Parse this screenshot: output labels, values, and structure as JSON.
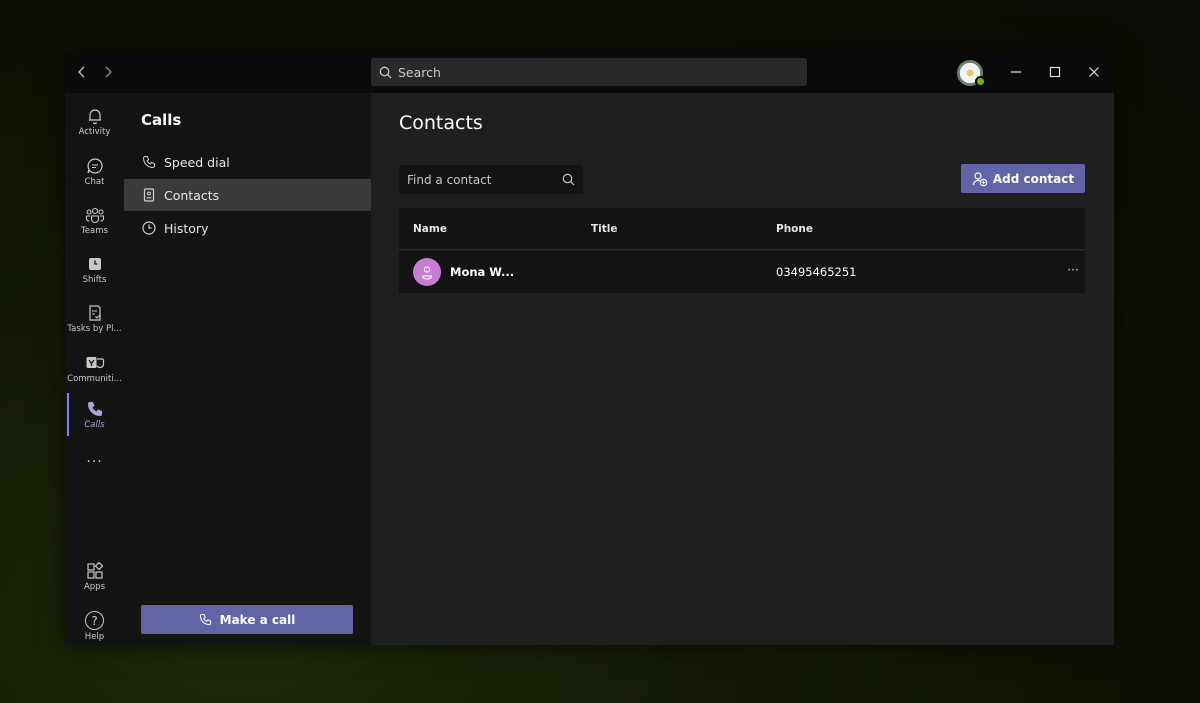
{
  "titlebar": {
    "search_placeholder": "Search"
  },
  "rail": {
    "items": [
      {
        "label": "Activity",
        "icon": "bell-icon"
      },
      {
        "label": "Chat",
        "icon": "chat-icon"
      },
      {
        "label": "Teams",
        "icon": "teams-icon"
      },
      {
        "label": "Shifts",
        "icon": "clock-icon"
      },
      {
        "label": "Tasks by Pl...",
        "icon": "tasks-icon"
      },
      {
        "label": "Communiti...",
        "icon": "communities-icon"
      },
      {
        "label": "Calls",
        "icon": "phone-icon"
      }
    ],
    "more": "···",
    "apps_label": "Apps",
    "help_label": "Help",
    "help_glyph": "?"
  },
  "calls_panel": {
    "title": "Calls",
    "nav": [
      {
        "label": "Speed dial",
        "icon": "phone-icon"
      },
      {
        "label": "Contacts",
        "icon": "contact-card-icon"
      },
      {
        "label": "History",
        "icon": "clock-icon"
      }
    ],
    "make_call_label": "Make a call"
  },
  "main": {
    "title": "Contacts",
    "find_placeholder": "Find a contact",
    "add_contact_label": "Add contact",
    "columns": [
      "Name",
      "Title",
      "Phone"
    ],
    "rows": [
      {
        "name": "Mona W...",
        "title": "",
        "phone": "03495465251"
      }
    ],
    "more_glyph": "···"
  },
  "colors": {
    "accent": "#6264a7",
    "accent_light": "#7f85f5",
    "avatar": "#c77dd1",
    "presence": "#6bb700"
  }
}
